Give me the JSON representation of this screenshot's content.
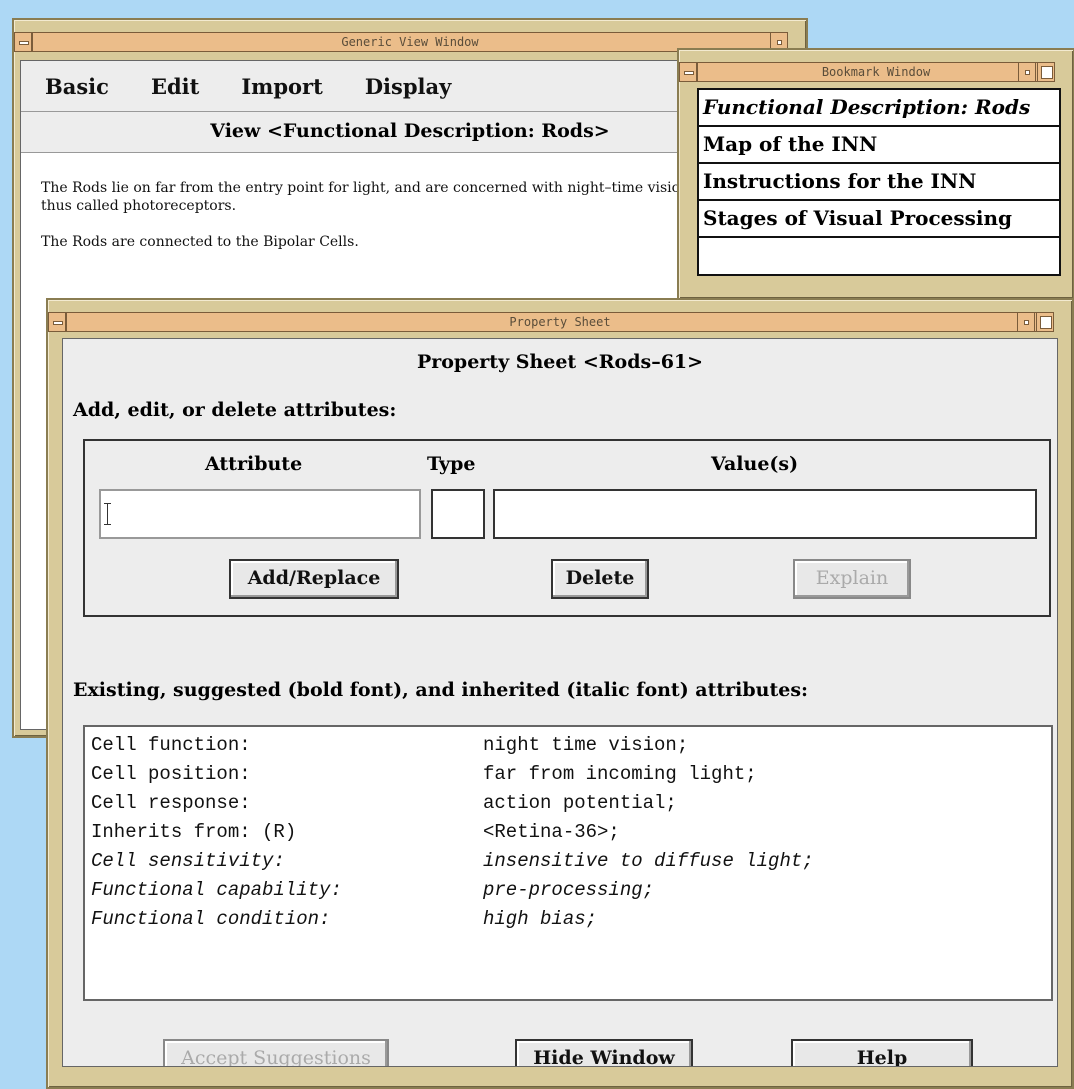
{
  "generic_view": {
    "window_title": "Generic View Window",
    "menu": [
      "Basic",
      "Edit",
      "Import",
      "Display"
    ],
    "view_title": "View <Functional Description: Rods>",
    "body": [
      "The Rods lie on far from the entry point for light, and are concerned with night–time vision, and are thus called photoreceptors.",
      "The Rods are connected to the Bipolar Cells."
    ]
  },
  "bookmark": {
    "window_title": "Bookmark Window",
    "items": [
      "Functional Description: Rods",
      "Map of the INN",
      "Instructions for the INN",
      "Stages of Visual Processing",
      ""
    ]
  },
  "property_sheet": {
    "window_title": "Property Sheet",
    "heading": "Property Sheet <Rods–61>",
    "add_label": "Add, edit, or delete attributes:",
    "col_attribute": "Attribute",
    "col_type": "Type",
    "col_values": "Value(s)",
    "attribute_value": "",
    "type_value": "",
    "values_value": "",
    "btn_add": "Add/Replace",
    "btn_delete": "Delete",
    "btn_explain": "Explain",
    "existing_label": "Existing, suggested (bold font), and inherited (italic font) attributes:",
    "attributes": [
      {
        "key": "Cell function:",
        "value": "night time vision;",
        "style": "normal"
      },
      {
        "key": "Cell position:",
        "value": "far from incoming light;",
        "style": "normal"
      },
      {
        "key": "Cell response:",
        "value": "action potential;",
        "style": "normal"
      },
      {
        "key": "Inherits from: (R)",
        "value": "<Retina-36>;",
        "style": "normal"
      },
      {
        "key": "Cell sensitivity:",
        "value": "insensitive to diffuse light;",
        "style": "inherited"
      },
      {
        "key": "Functional capability:",
        "value": "pre-processing;",
        "style": "inherited"
      },
      {
        "key": "Functional condition:",
        "value": "high bias;",
        "style": "inherited"
      }
    ],
    "btn_accept": "Accept Suggestions",
    "btn_hide": "Hide Window",
    "btn_help": "Help"
  }
}
